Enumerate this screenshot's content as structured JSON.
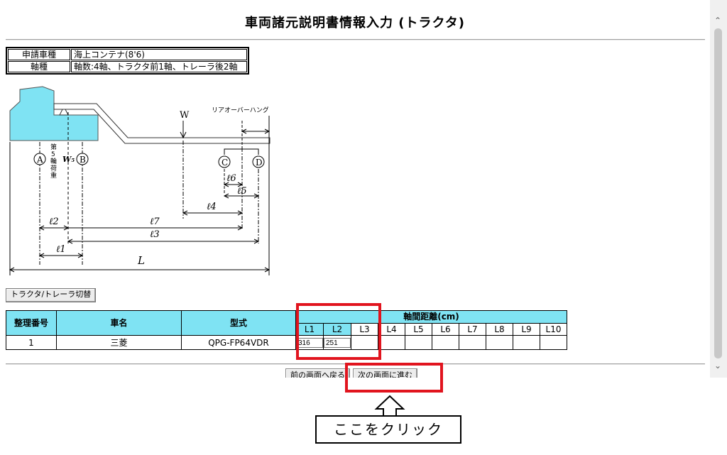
{
  "page": {
    "title": "車両諸元説明書情報入力 (トラクタ)"
  },
  "info": {
    "rows": [
      {
        "label": "申請車種",
        "value": "海上コンテナ(8'6)"
      },
      {
        "label": "軸種",
        "value": "軸数:4軸、トラクタ前1軸、トレーラ後2軸"
      }
    ]
  },
  "diagram": {
    "rear_overhang": "リアオーバーハング",
    "w": "W",
    "w5": "W₅",
    "fifth_wheel": [
      "第",
      "5",
      "輪",
      "荷",
      "重"
    ],
    "axles": [
      "A",
      "B",
      "C",
      "D"
    ],
    "dims": {
      "l1": "ℓ1",
      "l2": "ℓ2",
      "l3": "ℓ3",
      "l4": "ℓ4",
      "l5": "ℓ5",
      "l6": "ℓ6",
      "l7": "ℓ7",
      "L": "L"
    }
  },
  "switch_button": "トラクタ/トレーラ切替",
  "table": {
    "h_no": "整理番号",
    "h_name": "車名",
    "h_model": "型式",
    "h_axle_group": "軸間距離(cm)",
    "axle_cols": [
      "L1",
      "L2",
      "L3",
      "L4",
      "L5",
      "L6",
      "L7",
      "L8",
      "L9",
      "L10"
    ],
    "row": {
      "no": "1",
      "name": "三菱",
      "model": "QPG-FP64VDR",
      "L1": "316",
      "L2": "251"
    }
  },
  "nav": {
    "prev": "前の画面へ戻る",
    "next": "次の画面に進む"
  },
  "callout": "ここをクリック",
  "colors": {
    "header_bg": "#7fe3f3",
    "vehicle_fill": "#7fe3f3",
    "highlight": "#e1141e"
  }
}
